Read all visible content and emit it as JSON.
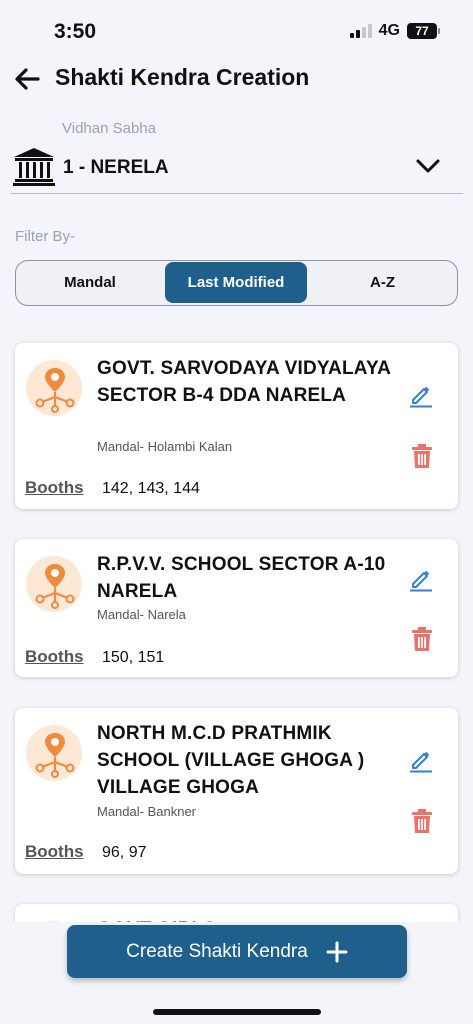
{
  "status": {
    "time": "3:50",
    "network": "4G",
    "battery": "77"
  },
  "header": {
    "title": "Shakti Kendra Creation"
  },
  "vidhan_sabha": {
    "label": "Vidhan Sabha",
    "value": "1 - NERELA"
  },
  "filter": {
    "label": "Filter By-",
    "options": [
      "Mandal",
      "Last Modified",
      "A-Z"
    ],
    "selected": "Last Modified"
  },
  "cards": [
    {
      "name": "GOVT. SARVODAYA VIDYALAYA SECTOR B-4 DDA NARELA",
      "mandal": "Mandal- Holambi Kalan",
      "booths_label": "Booths",
      "booths": "142, 143, 144"
    },
    {
      "name": "R.P.V.V. SCHOOL SECTOR A-10 NARELA",
      "mandal": "Mandal- Narela",
      "booths_label": "Booths",
      "booths": "150, 151"
    },
    {
      "name": "NORTH M.C.D PRATHMIK SCHOOL (VILLAGE GHOGA ) VILLAGE GHOGA",
      "mandal": "Mandal- Bankner",
      "booths_label": "Booths",
      "booths": "96, 97"
    },
    {
      "name": "GOVT GIRLS",
      "mandal": "",
      "booths_label": "",
      "booths": ""
    }
  ],
  "create_button": {
    "label": "Create Shakti Kendra"
  },
  "colors": {
    "primary": "#1f5f8b",
    "edit": "#2f7fd6",
    "delete": "#e8736b",
    "icon_bg": "#fde8d6",
    "icon_fg": "#f08a3c"
  }
}
